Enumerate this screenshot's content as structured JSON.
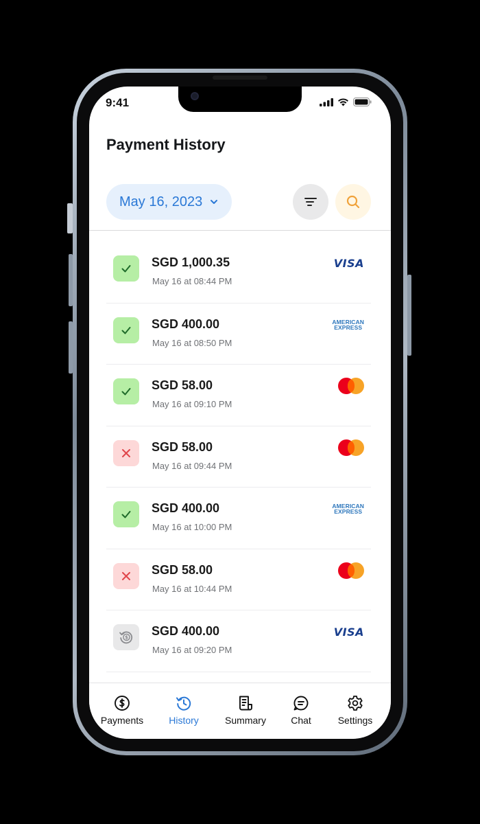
{
  "status_bar": {
    "time": "9:41"
  },
  "page": {
    "title": "Payment History"
  },
  "date_filter": {
    "label": "May 16, 2023"
  },
  "transactions": [
    {
      "amount": "SGD 1,000.35",
      "time": "May 16 at 08:44 PM",
      "status": "success",
      "card": "visa"
    },
    {
      "amount": "SGD 400.00",
      "time": "May 16 at 08:50 PM",
      "status": "success",
      "card": "amex"
    },
    {
      "amount": "SGD 58.00",
      "time": "May 16 at 09:10 PM",
      "status": "success",
      "card": "mastercard"
    },
    {
      "amount": "SGD 58.00",
      "time": "May 16 at 09:44 PM",
      "status": "failed",
      "card": "mastercard"
    },
    {
      "amount": "SGD 400.00",
      "time": "May 16 at 10:00 PM",
      "status": "success",
      "card": "amex"
    },
    {
      "amount": "SGD 58.00",
      "time": "May 16 at 10:44 PM",
      "status": "failed",
      "card": "mastercard"
    },
    {
      "amount": "SGD 400.00",
      "time": "May 16 at 09:20 PM",
      "status": "refund",
      "card": "visa"
    }
  ],
  "card_logos": {
    "visa": "VISA",
    "amex_line1": "AMERICAN",
    "amex_line2": "EXPRESS"
  },
  "nav": {
    "items": [
      {
        "label": "Payments",
        "icon": "dollar-circle-icon"
      },
      {
        "label": "History",
        "icon": "history-icon",
        "active": true
      },
      {
        "label": "Summary",
        "icon": "receipt-icon"
      },
      {
        "label": "Chat",
        "icon": "chat-icon"
      },
      {
        "label": "Settings",
        "icon": "gear-icon"
      }
    ]
  },
  "colors": {
    "accent": "#2a78d6",
    "success_bg": "#b6eea5",
    "failed_bg": "#fdd8d8",
    "refund_bg": "#e8e8e9",
    "search_bg": "#fff6e3"
  }
}
